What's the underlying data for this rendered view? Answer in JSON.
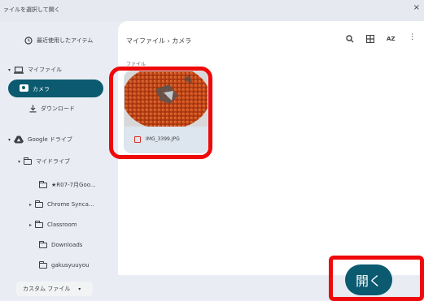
{
  "window": {
    "title": "ァイルを選択して開く",
    "close_icon": "×"
  },
  "sidebar": {
    "recent": "最近使用したアイテム",
    "my_files": "マイファイル",
    "camera": "カメラ",
    "downloads": "ダウンロード",
    "google_drive": "Google ドライブ",
    "my_drive": "マイドライブ",
    "folders": [
      "★R07-7月Goo...",
      "Chrome Synca...",
      "Classroom",
      "Downloads",
      "gakusyuuyou"
    ]
  },
  "main": {
    "breadcrumb": "マイファイル  ›  カメラ",
    "section_label": "ファイル",
    "file_name": "IMG_3399.JPG",
    "toolbar_icons": [
      "search-icon",
      "grid-view-icon",
      "sort-icon",
      "more-icon"
    ],
    "sort_label": "AZ"
  },
  "footer": {
    "filter_label": "カスタム ファイル",
    "filter_chevron": "▾",
    "open_button": "開く"
  },
  "colors": {
    "accent": "#0b5a70",
    "highlight": "#ee0a0a",
    "sidebar_bg": "#e9edf3"
  }
}
